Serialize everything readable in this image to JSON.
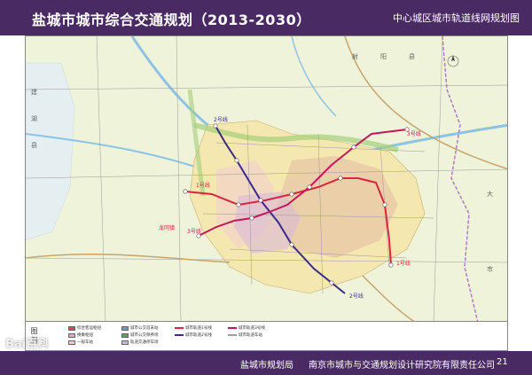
{
  "header": {
    "title": "盐城市城市综合交通规划（2013-2030）",
    "subtitle": "中心城区城市轨道线网规划图"
  },
  "map": {
    "county_labels": [
      "射",
      "阳",
      "县",
      "建",
      "湖",
      "县",
      "大",
      "市"
    ],
    "town_label": "龙冈镇",
    "line_labels": {
      "line1_north": "1号线",
      "line1_east": "1号线",
      "line2_north": "2号线",
      "line2_south": "2号线",
      "line3_west": "3号线",
      "line3_east": "3号线"
    },
    "line_colors": {
      "line1": "#d7263d",
      "line2": "#3b2a8c",
      "line3": "#c2185b"
    }
  },
  "legend": {
    "title": "图 例",
    "items": [
      {
        "label": "综合客运枢纽",
        "color": "#e8473c",
        "kind": "swatch"
      },
      {
        "label": "城市公交首末站",
        "color": "#6b9ad1",
        "kind": "swatch"
      },
      {
        "label": "城市轨道1号线",
        "color": "#d7263d",
        "kind": "line"
      },
      {
        "label": "城市轨道3号线",
        "color": "#c2185b",
        "kind": "line"
      },
      {
        "label": "换乘枢纽",
        "color": "#f2a2c0",
        "kind": "swatch"
      },
      {
        "label": "城市公交保养场",
        "color": "#4caf50",
        "kind": "swatch"
      },
      {
        "label": "城市轨道2号线",
        "color": "#3b2a8c",
        "kind": "line"
      },
      {
        "label": "城市轨道车站",
        "color": "#9e9e9e",
        "kind": "line"
      },
      {
        "label": "一般车站",
        "color": "#fbc1d6",
        "kind": "swatch"
      },
      {
        "label": "轨道交通停车场",
        "color": "#c7b8e0",
        "kind": "swatch"
      },
      {
        "label": "",
        "color": "#ffffff",
        "kind": "blank"
      },
      {
        "label": "",
        "color": "#ffffff",
        "kind": "blank"
      }
    ]
  },
  "footer": {
    "org1": "盐城市规划局",
    "org2": "南京市城市与交通规划设计研究院有限责任公司",
    "page": "21"
  },
  "watermark": "Bai百科"
}
